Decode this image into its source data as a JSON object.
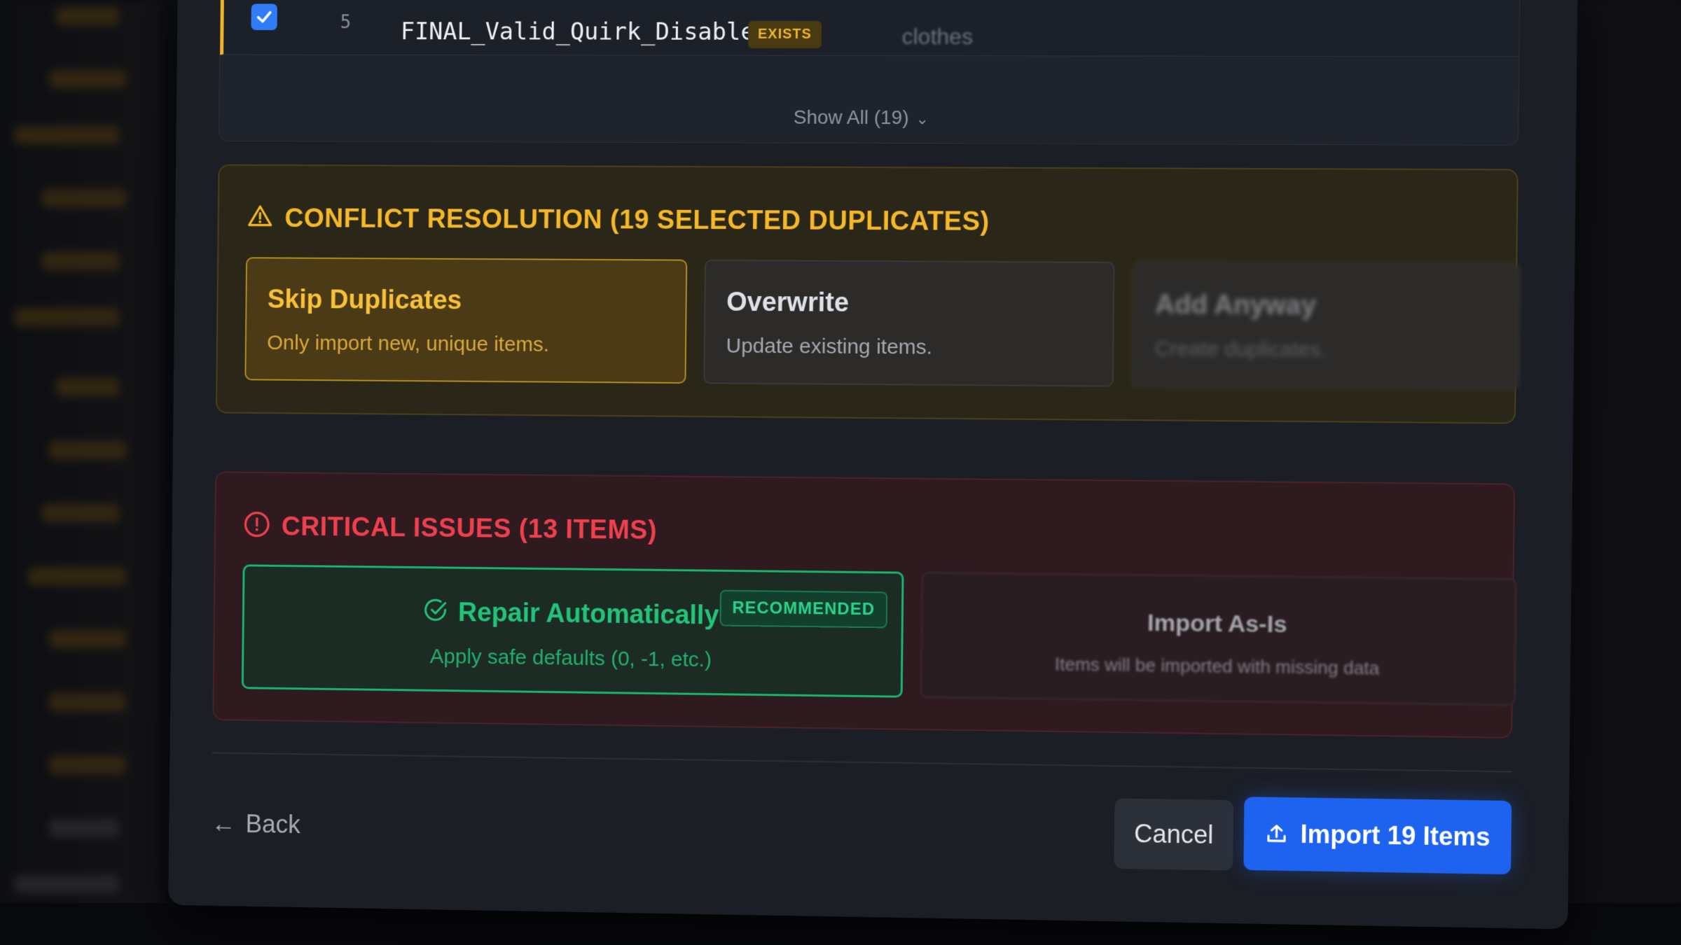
{
  "row": {
    "checked": true,
    "index": "5",
    "name": "FINAL_Valid_Quirk_Disabled",
    "badge": "EXISTS",
    "category": "clothes"
  },
  "table": {
    "show_all_label": "Show All (19)"
  },
  "conflict_resolution": {
    "title": "CONFLICT RESOLUTION (19 SELECTED DUPLICATES)",
    "options": [
      {
        "title": "Skip Duplicates",
        "description": "Only import new, unique items.",
        "selected": true
      },
      {
        "title": "Overwrite",
        "description": "Update existing items.",
        "selected": false
      },
      {
        "title": "Add Anyway",
        "description": "Create duplicates.",
        "selected": false
      }
    ]
  },
  "critical_issues": {
    "title": "CRITICAL ISSUES (13 ITEMS)",
    "repair": {
      "title": "Repair Automatically",
      "description": "Apply safe defaults (0, -1, etc.)",
      "badge": "RECOMMENDED",
      "selected": true
    },
    "as_is": {
      "title": "Import As-Is",
      "description": "Items will be imported with missing data"
    }
  },
  "footer": {
    "back_label": "Back",
    "cancel_label": "Cancel",
    "import_label": "Import 19 Items"
  },
  "colors": {
    "warning": "#f5b82a",
    "danger": "#f0404e",
    "success": "#22c47a",
    "primary": "#1d63f0"
  }
}
